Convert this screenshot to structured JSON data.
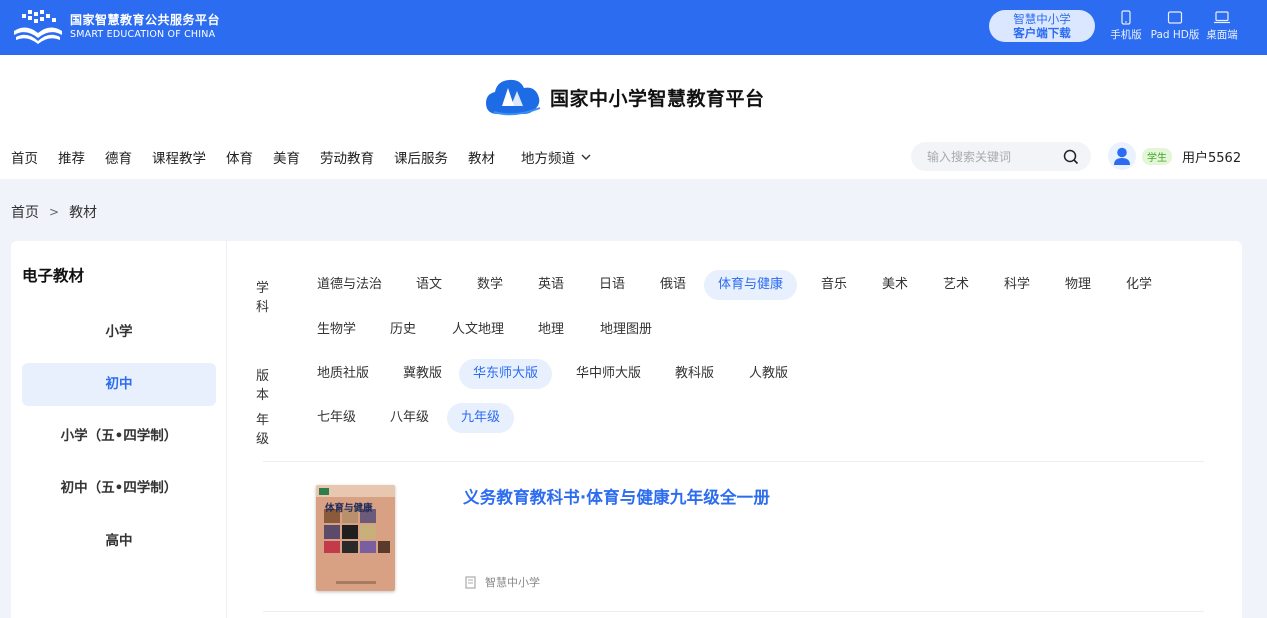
{
  "topbar": {
    "logo_cn": "国家智慧教育公共服务平台",
    "logo_en": "SMART EDUCATION OF CHINA",
    "download_line1": "智慧中小学",
    "download_line2": "客户端下载",
    "devices": [
      {
        "label": "手机版",
        "icon": "phone-icon"
      },
      {
        "label": "Pad HD版",
        "icon": "tablet-icon"
      },
      {
        "label": "桌面端",
        "icon": "laptop-icon"
      }
    ]
  },
  "header": {
    "brand_title": "国家中小学智慧教育平台",
    "nav": [
      "首页",
      "推荐",
      "德育",
      "课程教学",
      "体育",
      "美育",
      "劳动教育",
      "课后服务",
      "教材"
    ],
    "nav_local": "地方频道",
    "search_placeholder": "输入搜索关键词",
    "role_badge": "学生",
    "username": "用户5562"
  },
  "breadcrumb": {
    "home": "首页",
    "separator": ">",
    "current": "教材"
  },
  "sidebar": {
    "title": "电子教材",
    "items": [
      "小学",
      "初中",
      "小学（五•四学制）",
      "初中（五•四学制）",
      "高中"
    ],
    "active_index": 1
  },
  "filters": {
    "subject_label": "学科",
    "subjects_row1": [
      "道德与法治",
      "语文",
      "数学",
      "英语",
      "日语",
      "俄语",
      "体育与健康",
      "音乐",
      "美术",
      "艺术",
      "科学",
      "物理",
      "化学"
    ],
    "subjects_row2": [
      "生物学",
      "历史",
      "人文地理",
      "地理",
      "地理图册"
    ],
    "subject_active": "体育与健康",
    "edition_label": "版本",
    "editions": [
      "地质社版",
      "冀教版",
      "华东师大版",
      "华中师大版",
      "教科版",
      "人教版"
    ],
    "edition_active": "华东师大版",
    "grade_label": "年级",
    "grades": [
      "七年级",
      "八年级",
      "九年级"
    ],
    "grade_active": "九年级"
  },
  "book": {
    "title": "义务教育教科书·体育与健康九年级全一册",
    "source": "智慧中小学",
    "cover_title": "体育与健康"
  },
  "colors": {
    "brand_blue": "#2c6cf0",
    "active_bg": "#e8f0fd",
    "badge_green": "#46a52b"
  }
}
